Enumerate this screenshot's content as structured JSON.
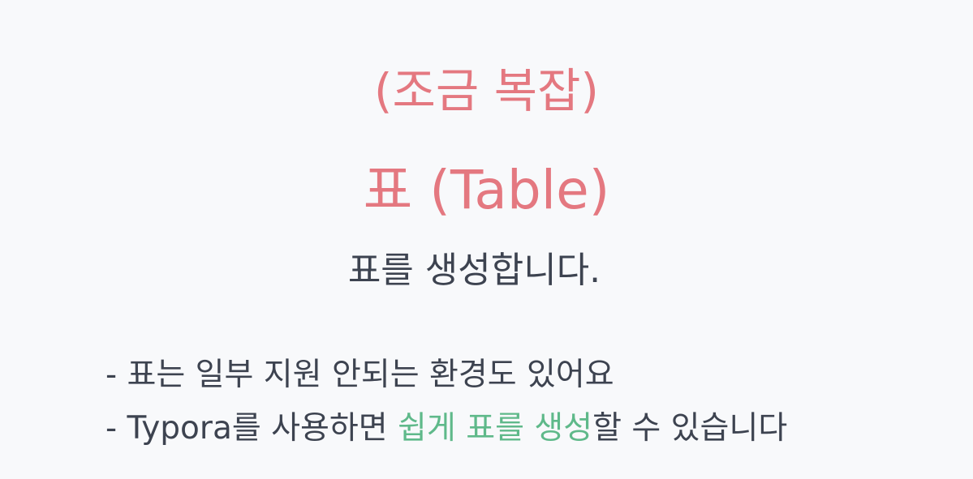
{
  "slide": {
    "subtitle": "(조금 복잡)",
    "title": "표 (Table)",
    "description": "표를 생성합니다.",
    "bullets": [
      {
        "text": "- 표는 일부 지원 안되는 환경도 있어요"
      },
      {
        "prefix": "- Typora를 사용하면 ",
        "highlight": "쉽게 표를 생성",
        "suffix": "할 수 있습니다"
      }
    ]
  },
  "colors": {
    "background": "#f8f9fb",
    "title": "#e47880",
    "body_text": "#3d4350",
    "highlight": "#5fb98a"
  }
}
